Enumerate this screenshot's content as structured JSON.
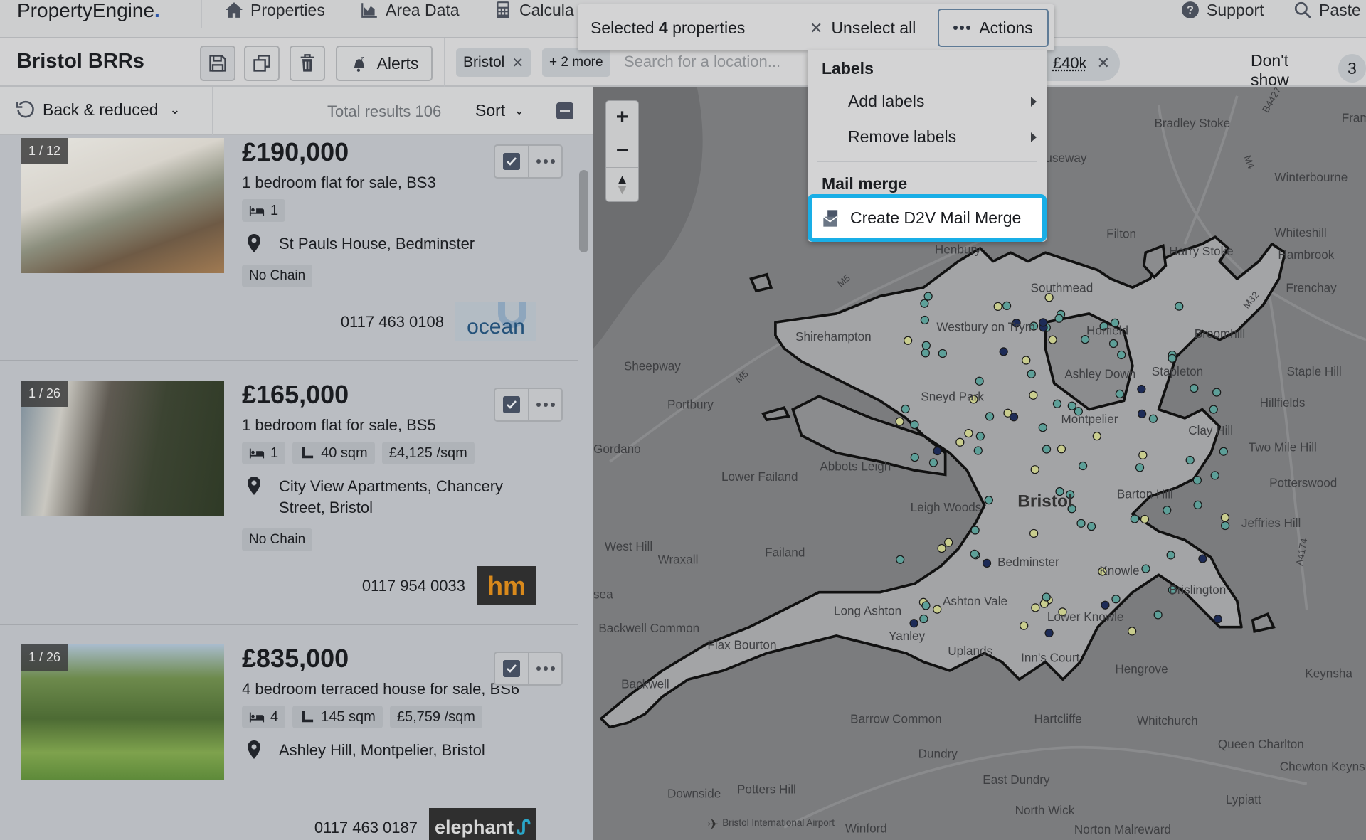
{
  "nav": {
    "logo": "PropertyEngine",
    "logo_dot": ".",
    "items": [
      {
        "label": "Properties",
        "icon": "house-icon"
      },
      {
        "label": "Area Data",
        "icon": "area-chart-icon"
      },
      {
        "label": "Calcula",
        "icon": "calculator-icon"
      }
    ],
    "support": "Support",
    "paste": "Paste"
  },
  "toolbar": {
    "title": "Bristol BRRs",
    "alerts": "Alerts",
    "location_chips": [
      "Bristol",
      "+ 2 more"
    ],
    "search_placeholder": "Search for a location...",
    "price_chip": "£40k",
    "dont_show": "Don't show",
    "dont_show_count": "3"
  },
  "list_header": {
    "filter": "Back & reduced",
    "total": "Total results 106",
    "sort": "Sort"
  },
  "selection": {
    "count_prefix": "Selected ",
    "count": "4",
    "count_suffix": " properties",
    "unselect": "Unselect all",
    "actions": "Actions"
  },
  "actions_menu": {
    "labels_header": "Labels",
    "add_labels": "Add labels",
    "remove_labels": "Remove labels",
    "mail_header": "Mail merge",
    "create_mail_merge": "Create D2V Mail Merge",
    "highlight_color": "#19aee6"
  },
  "cards": [
    {
      "photo_counter": "1 / 12",
      "price": "£190,000",
      "description": "1 bedroom flat for sale, BS3",
      "beds": "1",
      "address": "St Pauls House, Bedminster",
      "tag": "No Chain",
      "phone": "0117 463 0108",
      "agent_logo": "ocean",
      "selected": true
    },
    {
      "photo_counter": "1 / 26",
      "price": "£165,000",
      "description": "1 bedroom flat for sale, BS5",
      "beds": "1",
      "area": "40 sqm",
      "price_per_sqm": "£4,125 /sqm",
      "address": "City View Apartments, Chancery Street, Bristol",
      "tag": "No Chain",
      "phone": "0117 954 0033",
      "agent_logo": "hm",
      "selected": true
    },
    {
      "photo_counter": "1 / 26",
      "price": "£835,000",
      "description": "4 bedroom terraced house for sale, BS6",
      "beds": "4",
      "area": "145 sqm",
      "price_per_sqm": "£5,759 /sqm",
      "address": "Ashley Hill, Montpelier, Bristol",
      "phone": "0117 463 0187",
      "agent_logo": "elephant",
      "selected": true
    }
  ],
  "map": {
    "labels": [
      "Bradley Stoke",
      "Fram",
      "useway",
      "Winterbourne",
      "Filton",
      "Whiteshill",
      "Harry Stoke",
      "Hambrook",
      "Henbury",
      "Southmead",
      "Frenchay",
      "Shirehampton",
      "Westbury on Trym",
      "Horfield",
      "Broomhill",
      "Sheepway",
      "Ashley Down",
      "Stapleton",
      "Staple Hill",
      "Portbury",
      "Sneyd Park",
      "Hillfields",
      "Montpelier",
      "Clay Hill",
      "Gordano",
      "Two Mile Hill",
      "Abbots Leigh",
      "Lower Failand",
      "Barton Hill",
      "Potterswood",
      "Leigh Woods",
      "Jeffries Hill",
      "West Hill",
      "Wraxall",
      "Failand",
      "Bedminster",
      "Knowle",
      "Brislington",
      "sea",
      "Long Ashton",
      "Ashton Vale",
      "Lower Knowle",
      "Backwell Common",
      "Flax Bourton",
      "Yanley",
      "Uplands",
      "Inn's Court",
      "Hengrove",
      "Keynsha",
      "Backwell",
      "Barrow Common",
      "Hartcliffe",
      "Whitchurch",
      "Queen Charlton",
      "Dundry",
      "Chewton Keynsh",
      "East Dundry",
      "Downside",
      "Potters Hill",
      "Lypiatt",
      "North Wick",
      "Bristol International Airport",
      "Winford",
      "Norton Malreward"
    ],
    "city_label": "Bristol",
    "roads": [
      "M5",
      "M5",
      "M32",
      "M4",
      "B4427",
      "A4174"
    ],
    "marker_colors": [
      "#5d9f98",
      "#c9cd8e",
      "#1d2b57"
    ]
  }
}
